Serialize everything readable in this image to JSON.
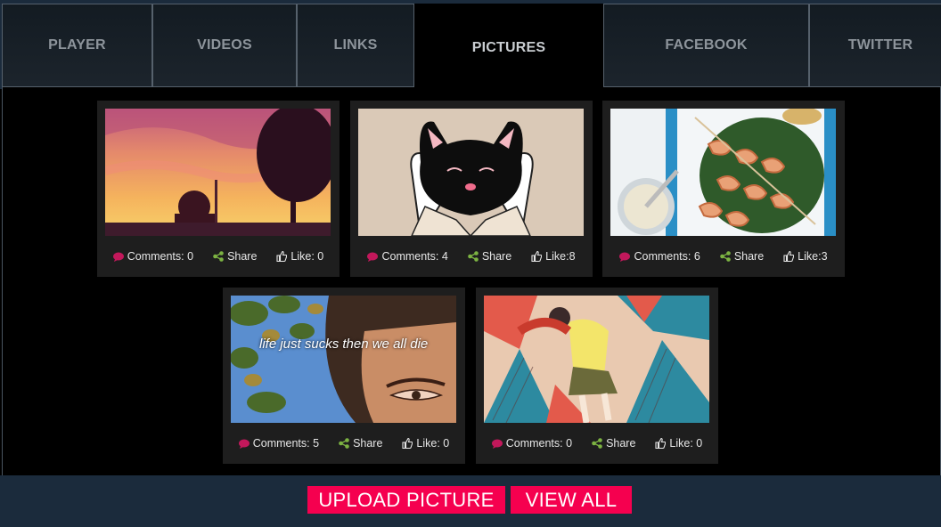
{
  "tabs": [
    {
      "label": "PLAYER"
    },
    {
      "label": "VIDEOS"
    },
    {
      "label": "LINKS"
    },
    {
      "label": "PICTURES",
      "active": true
    },
    {
      "label": "FACEBOOK"
    },
    {
      "label": "TWITTER"
    }
  ],
  "pictures": [
    {
      "image": "sunset-silhouette",
      "comments": "Comments: 0",
      "share": "Share",
      "like": "Like: 0"
    },
    {
      "image": "black-cat-hands",
      "comments": "Comments: 4",
      "share": "Share",
      "like": "Like:8"
    },
    {
      "image": "shrimp-skewers",
      "comments": "Comments: 6",
      "share": "Share",
      "like": "Like:3"
    },
    {
      "image": "face-with-caption",
      "caption": "life just sucks then we all die",
      "comments": "Comments: 5",
      "share": "Share",
      "like": "Like: 0"
    },
    {
      "image": "anime-city-fall",
      "comments": "Comments: 0",
      "share": "Share",
      "like": "Like: 0"
    }
  ],
  "actions": {
    "upload_label": "UPLOAD PICTURE",
    "view_all_label": "VIEW ALL"
  },
  "icons": {
    "comment": "comment-icon",
    "share": "share-icon",
    "like": "thumbs-up-icon"
  },
  "colors": {
    "accent": "#f5004f",
    "comment_icon": "#c2185b",
    "share_icon": "#7cb342",
    "bar": "#1b2b3c"
  }
}
